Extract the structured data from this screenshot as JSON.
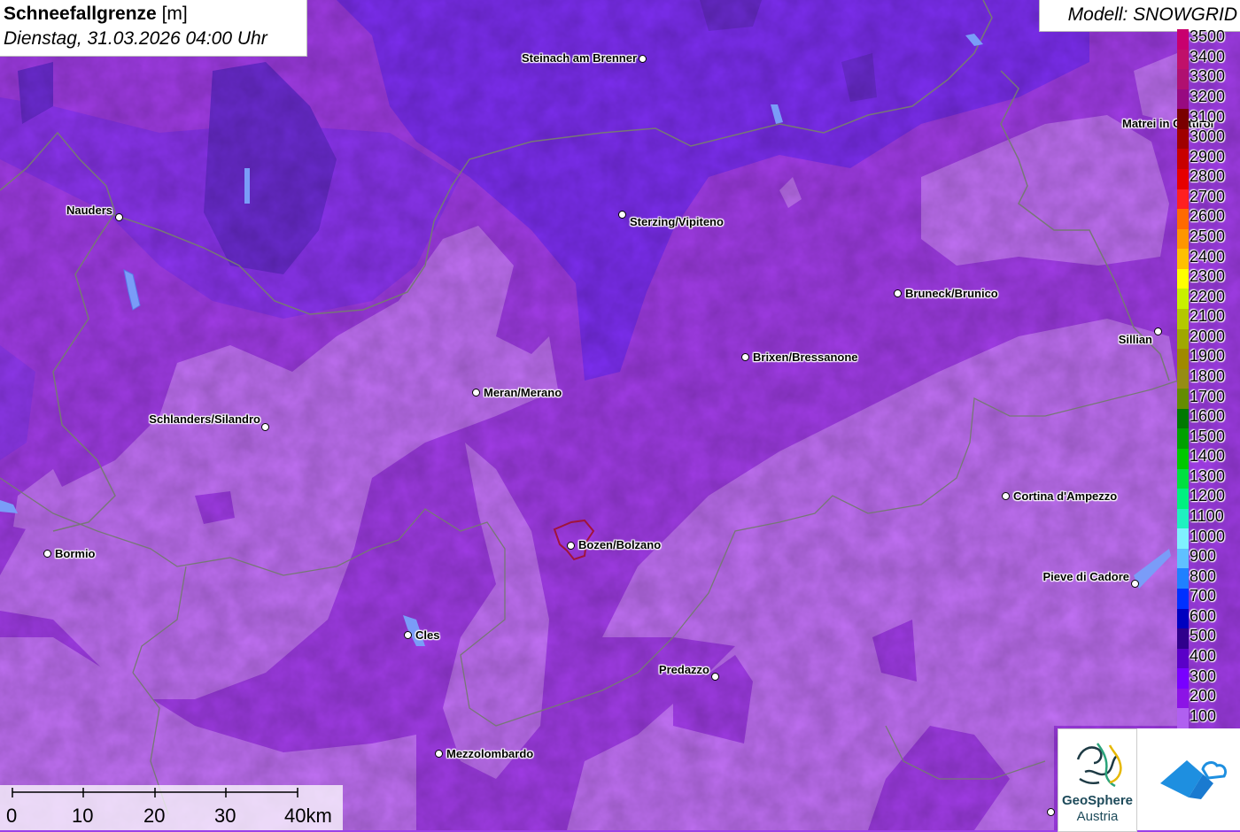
{
  "header": {
    "title_bold": "Schneefallgrenze",
    "title_unit": "[m]",
    "datetime": "Dienstag, 31.03.2026 04:00 Uhr"
  },
  "model": {
    "label": "Modell: SNOWGRID"
  },
  "cities": [
    {
      "name": "Steinach am Brenner",
      "label_side": "left"
    },
    {
      "name": "Nauders",
      "label_side": "left"
    },
    {
      "name": "Sterzing/Vipiteno",
      "label_side": "right"
    },
    {
      "name": "Matrei in Osttirol",
      "label_side": "left"
    },
    {
      "name": "Bruneck/Brunico",
      "label_side": "right"
    },
    {
      "name": "Sillian",
      "label_side": "left"
    },
    {
      "name": "Brixen/Bressanone",
      "label_side": "right"
    },
    {
      "name": "Meran/Merano",
      "label_side": "right"
    },
    {
      "name": "Schlanders/Silandro",
      "label_side": "left"
    },
    {
      "name": "Cortina d'Ampezzo",
      "label_side": "right"
    },
    {
      "name": "Bormio",
      "label_side": "right"
    },
    {
      "name": "Bozen/Bolzano",
      "label_side": "right"
    },
    {
      "name": "Pieve di Cadore",
      "label_side": "left"
    },
    {
      "name": "Cles",
      "label_side": "right"
    },
    {
      "name": "Predazzo",
      "label_side": "left"
    },
    {
      "name": "Mezzolombardo",
      "label_side": "right"
    }
  ],
  "legend": {
    "unit": "m",
    "entries": [
      {
        "value": "3500",
        "color": "#c8006e"
      },
      {
        "value": "3400",
        "color": "#c0106a"
      },
      {
        "value": "3300",
        "color": "#b01070"
      },
      {
        "value": "3200",
        "color": "#980a80"
      },
      {
        "value": "3100",
        "color": "#7a0000"
      },
      {
        "value": "3000",
        "color": "#a00000"
      },
      {
        "value": "2900",
        "color": "#c80000"
      },
      {
        "value": "2800",
        "color": "#e60000"
      },
      {
        "value": "2700",
        "color": "#ff2020"
      },
      {
        "value": "2600",
        "color": "#ff6a00"
      },
      {
        "value": "2500",
        "color": "#ff9600"
      },
      {
        "value": "2400",
        "color": "#ffc000"
      },
      {
        "value": "2300",
        "color": "#ffff00"
      },
      {
        "value": "2200",
        "color": "#c8f000"
      },
      {
        "value": "2100",
        "color": "#b4c800"
      },
      {
        "value": "2000",
        "color": "#a0a800"
      },
      {
        "value": "1900",
        "color": "#a08a00"
      },
      {
        "value": "1800",
        "color": "#968c14"
      },
      {
        "value": "1700",
        "color": "#648c00"
      },
      {
        "value": "1600",
        "color": "#007800"
      },
      {
        "value": "1500",
        "color": "#00a000"
      },
      {
        "value": "1400",
        "color": "#00c800"
      },
      {
        "value": "1300",
        "color": "#00e040"
      },
      {
        "value": "1200",
        "color": "#00f080"
      },
      {
        "value": "1100",
        "color": "#20f0c0"
      },
      {
        "value": "1000",
        "color": "#80f0ff"
      },
      {
        "value": "900",
        "color": "#60c0ff"
      },
      {
        "value": "800",
        "color": "#2080ff"
      },
      {
        "value": "700",
        "color": "#0030ff"
      },
      {
        "value": "600",
        "color": "#0000c0"
      },
      {
        "value": "500",
        "color": "#30008c"
      },
      {
        "value": "400",
        "color": "#5a00c8"
      },
      {
        "value": "300",
        "color": "#7800ff"
      },
      {
        "value": "200",
        "color": "#8c14e6"
      },
      {
        "value": "100",
        "color": "#b060f0"
      }
    ]
  },
  "scale_bar": {
    "labels": [
      "0",
      "10",
      "20",
      "30",
      "40km"
    ]
  },
  "logos": {
    "geosphere_line1": "GeoSphere",
    "geosphere_line2": "Austria"
  },
  "colors": {
    "band_low": "#c070f4",
    "band_mid": "#a03ce6",
    "band_high": "#7c2ef0",
    "band_peak": "#6a2bd0",
    "border_line": "#777777",
    "bolzano_outline": "#a0143c"
  }
}
